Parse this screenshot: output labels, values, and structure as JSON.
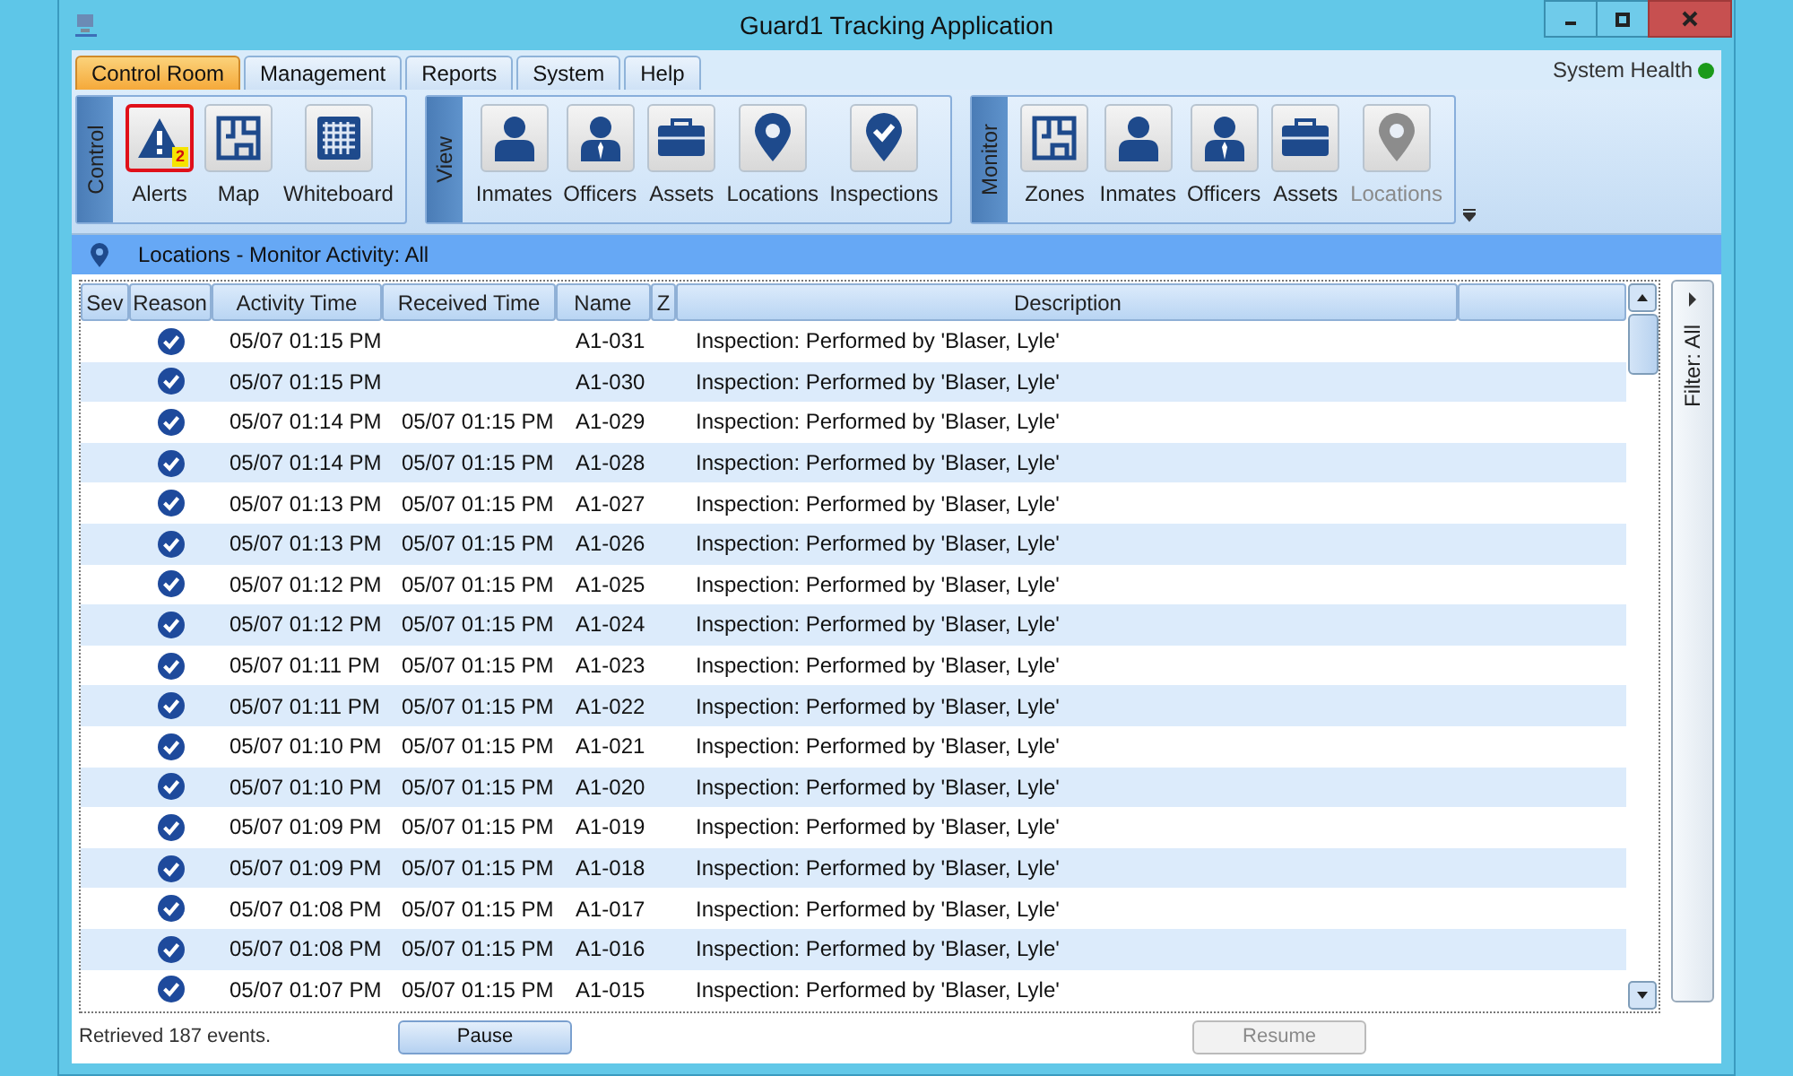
{
  "window": {
    "title": "Guard1 Tracking Application"
  },
  "tabs": [
    {
      "label": "Control Room",
      "selected": true
    },
    {
      "label": "Management",
      "selected": false
    },
    {
      "label": "Reports",
      "selected": false
    },
    {
      "label": "System",
      "selected": false
    },
    {
      "label": "Help",
      "selected": false
    }
  ],
  "system_health": {
    "label": "System Health",
    "color": "#1a9a1a"
  },
  "ribbon_groups": [
    {
      "title": "Control",
      "buttons": [
        {
          "label": "Alerts",
          "kind": "alert",
          "badge": "2",
          "selected": true,
          "disabled": false
        },
        {
          "label": "Map",
          "kind": "map",
          "selected": false,
          "disabled": false
        },
        {
          "label": "Whiteboard",
          "kind": "grid",
          "selected": false,
          "disabled": false
        }
      ]
    },
    {
      "title": "View",
      "buttons": [
        {
          "label": "Inmates",
          "kind": "person",
          "selected": false,
          "disabled": false
        },
        {
          "label": "Officers",
          "kind": "officer",
          "selected": false,
          "disabled": false
        },
        {
          "label": "Assets",
          "kind": "briefcase",
          "selected": false,
          "disabled": false
        },
        {
          "label": "Locations",
          "kind": "pin",
          "selected": false,
          "disabled": false
        },
        {
          "label": "Inspections",
          "kind": "checkpin",
          "selected": false,
          "disabled": false
        }
      ]
    },
    {
      "title": "Monitor",
      "buttons": [
        {
          "label": "Zones",
          "kind": "map",
          "selected": false,
          "disabled": false
        },
        {
          "label": "Inmates",
          "kind": "person",
          "selected": false,
          "disabled": false
        },
        {
          "label": "Officers",
          "kind": "officer",
          "selected": false,
          "disabled": false
        },
        {
          "label": "Assets",
          "kind": "briefcase",
          "selected": false,
          "disabled": false
        },
        {
          "label": "Locations",
          "kind": "pin",
          "selected": false,
          "disabled": true
        }
      ]
    }
  ],
  "location_bar": {
    "text": "Locations - Monitor Activity: All"
  },
  "table": {
    "columns": [
      "Sev",
      "Reason",
      "Activity Time",
      "Received Time",
      "Name",
      "Z",
      "Description"
    ],
    "rows": [
      {
        "activity_time": "05/07 01:15 PM",
        "received_time": "",
        "name": "A1-031",
        "description": "Inspection:  Performed by 'Blaser, Lyle'"
      },
      {
        "activity_time": "05/07 01:15 PM",
        "received_time": "",
        "name": "A1-030",
        "description": "Inspection:  Performed by 'Blaser, Lyle'"
      },
      {
        "activity_time": "05/07 01:14 PM",
        "received_time": "05/07 01:15 PM",
        "name": "A1-029",
        "description": "Inspection:  Performed by 'Blaser, Lyle'"
      },
      {
        "activity_time": "05/07 01:14 PM",
        "received_time": "05/07 01:15 PM",
        "name": "A1-028",
        "description": "Inspection:  Performed by 'Blaser, Lyle'"
      },
      {
        "activity_time": "05/07 01:13 PM",
        "received_time": "05/07 01:15 PM",
        "name": "A1-027",
        "description": "Inspection:  Performed by 'Blaser, Lyle'"
      },
      {
        "activity_time": "05/07 01:13 PM",
        "received_time": "05/07 01:15 PM",
        "name": "A1-026",
        "description": "Inspection:  Performed by 'Blaser, Lyle'"
      },
      {
        "activity_time": "05/07 01:12 PM",
        "received_time": "05/07 01:15 PM",
        "name": "A1-025",
        "description": "Inspection:  Performed by 'Blaser, Lyle'"
      },
      {
        "activity_time": "05/07 01:12 PM",
        "received_time": "05/07 01:15 PM",
        "name": "A1-024",
        "description": "Inspection:  Performed by 'Blaser, Lyle'"
      },
      {
        "activity_time": "05/07 01:11 PM",
        "received_time": "05/07 01:15 PM",
        "name": "A1-023",
        "description": "Inspection:  Performed by 'Blaser, Lyle'"
      },
      {
        "activity_time": "05/07 01:11 PM",
        "received_time": "05/07 01:15 PM",
        "name": "A1-022",
        "description": "Inspection:  Performed by 'Blaser, Lyle'"
      },
      {
        "activity_time": "05/07 01:10 PM",
        "received_time": "05/07 01:15 PM",
        "name": "A1-021",
        "description": "Inspection:  Performed by 'Blaser, Lyle'"
      },
      {
        "activity_time": "05/07 01:10 PM",
        "received_time": "05/07 01:15 PM",
        "name": "A1-020",
        "description": "Inspection:  Performed by 'Blaser, Lyle'"
      },
      {
        "activity_time": "05/07 01:09 PM",
        "received_time": "05/07 01:15 PM",
        "name": "A1-019",
        "description": "Inspection:  Performed by 'Blaser, Lyle'"
      },
      {
        "activity_time": "05/07 01:09 PM",
        "received_time": "05/07 01:15 PM",
        "name": "A1-018",
        "description": "Inspection:  Performed by 'Blaser, Lyle'"
      },
      {
        "activity_time": "05/07 01:08 PM",
        "received_time": "05/07 01:15 PM",
        "name": "A1-017",
        "description": "Inspection:  Performed by 'Blaser, Lyle'"
      },
      {
        "activity_time": "05/07 01:08 PM",
        "received_time": "05/07 01:15 PM",
        "name": "A1-016",
        "description": "Inspection:  Performed by 'Blaser, Lyle'"
      },
      {
        "activity_time": "05/07 01:07 PM",
        "received_time": "05/07 01:15 PM",
        "name": "A1-015",
        "description": "Inspection:  Performed by 'Blaser, Lyle'"
      }
    ]
  },
  "filter_panel": {
    "text": "Filter: All"
  },
  "status": {
    "text": "Retrieved 187 events."
  },
  "buttons": [
    {
      "label": "Pause",
      "disabled": false
    },
    {
      "label": "Resume",
      "disabled": true
    }
  ]
}
